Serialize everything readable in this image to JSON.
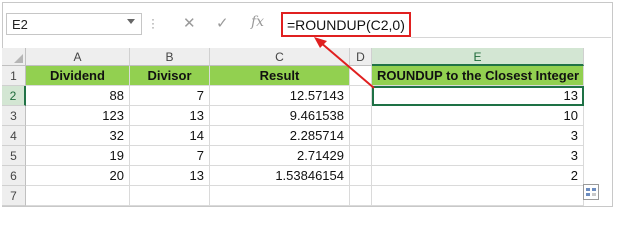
{
  "name_box": {
    "value": "E2"
  },
  "formula_bar": {
    "cancel_icon": "✕",
    "enter_icon": "✓",
    "fx_label": "fx",
    "formula": "=ROUNDUP(C2,0)"
  },
  "columns": [
    "A",
    "B",
    "C",
    "D",
    "E"
  ],
  "rows": [
    "1",
    "2",
    "3",
    "4",
    "5",
    "6",
    "7"
  ],
  "headers": {
    "a": "Dividend",
    "b": "Divisor",
    "c": "Result",
    "e": "ROUNDUP to the Closest Integer"
  },
  "data": [
    {
      "a": "88",
      "b": "7",
      "c": "12.57143",
      "e": "13"
    },
    {
      "a": "123",
      "b": "13",
      "c": "9.461538",
      "e": "10"
    },
    {
      "a": "32",
      "b": "14",
      "c": "2.285714",
      "e": "3"
    },
    {
      "a": "19",
      "b": "7",
      "c": "2.71429",
      "e": "3"
    },
    {
      "a": "20",
      "b": "13",
      "c": "1.53846154",
      "e": "2"
    }
  ],
  "colors": {
    "header_fill": "#92d050",
    "highlight_red": "#e02020",
    "selection_green": "#1e7145"
  }
}
